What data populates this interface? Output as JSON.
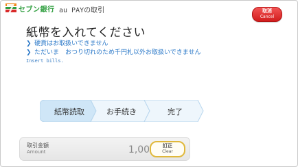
{
  "header": {
    "brand": "セブン銀行",
    "title": "au PAYの取引",
    "cancel": {
      "label_jp": "取消",
      "label_en": "Cancel"
    }
  },
  "main": {
    "headline": "紙幣を入れてください",
    "notes": [
      "硬貨はお取扱いできません",
      "ただいま　おつり切れのため千円札以外お取扱いできません"
    ],
    "subtext_en": "Insert bills."
  },
  "steps": [
    {
      "label": "紙幣読取",
      "active": true
    },
    {
      "label": "お手続き",
      "active": false
    },
    {
      "label": "完了",
      "active": false
    }
  ],
  "amount": {
    "label_jp": "取引金額",
    "label_en": "Amount",
    "value": "1,000円",
    "clear": {
      "label_jp": "訂正",
      "label_en": "Clear"
    }
  },
  "colors": {
    "brand_green": "#2e9e3e",
    "brand_orange": "#f08a1c",
    "brand_red": "#d92a2a",
    "note_blue": "#2a78c8",
    "step_active": "#cfe6f7",
    "step_inactive": "#eef6fc"
  }
}
